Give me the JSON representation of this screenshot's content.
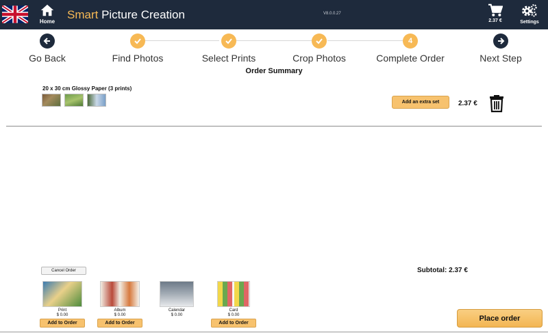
{
  "header": {
    "title_accent": "Smart",
    "title_rest": " Picture Creation",
    "version": "V8.0.0.27",
    "home_label": "Home",
    "cart_label": "2.37 €",
    "settings_label": "Settings",
    "flag": "uk-flag-icon",
    "colors": {
      "background": "#1e2a3c",
      "accent": "#f7b955"
    }
  },
  "steps": [
    {
      "label": "Go Back",
      "icon": "arrow-left-icon",
      "state": "nav"
    },
    {
      "label": "Find Photos",
      "icon": "check-icon",
      "state": "done"
    },
    {
      "label": "Select Prints",
      "icon": "check-icon",
      "state": "done"
    },
    {
      "label": "Crop Photos",
      "icon": "check-icon",
      "state": "done"
    },
    {
      "label": "Complete Order",
      "number": "4",
      "state": "current"
    },
    {
      "label": "Next Step",
      "icon": "arrow-right-icon",
      "state": "nav"
    }
  ],
  "order": {
    "title": "Order Summary",
    "item": {
      "description": "20 x 30 cm Glossy Paper (3 prints)",
      "extra_set_label": "Add an extra set",
      "price": "2.37 €"
    }
  },
  "footer": {
    "cancel_label": "Cancel Order",
    "subtotal": "Subtotal: 2.37 €",
    "place_order_label": "Place order",
    "products": [
      {
        "name": "Print",
        "price": "$ 0.00",
        "add_label": "Add to Order"
      },
      {
        "name": "Album",
        "price": "$ 0.00",
        "add_label": "Add to Order"
      },
      {
        "name": "Calendar",
        "price": "$ 0.00"
      },
      {
        "name": "Card",
        "price": "$ 0.00",
        "add_label": "Add to Order"
      }
    ]
  }
}
